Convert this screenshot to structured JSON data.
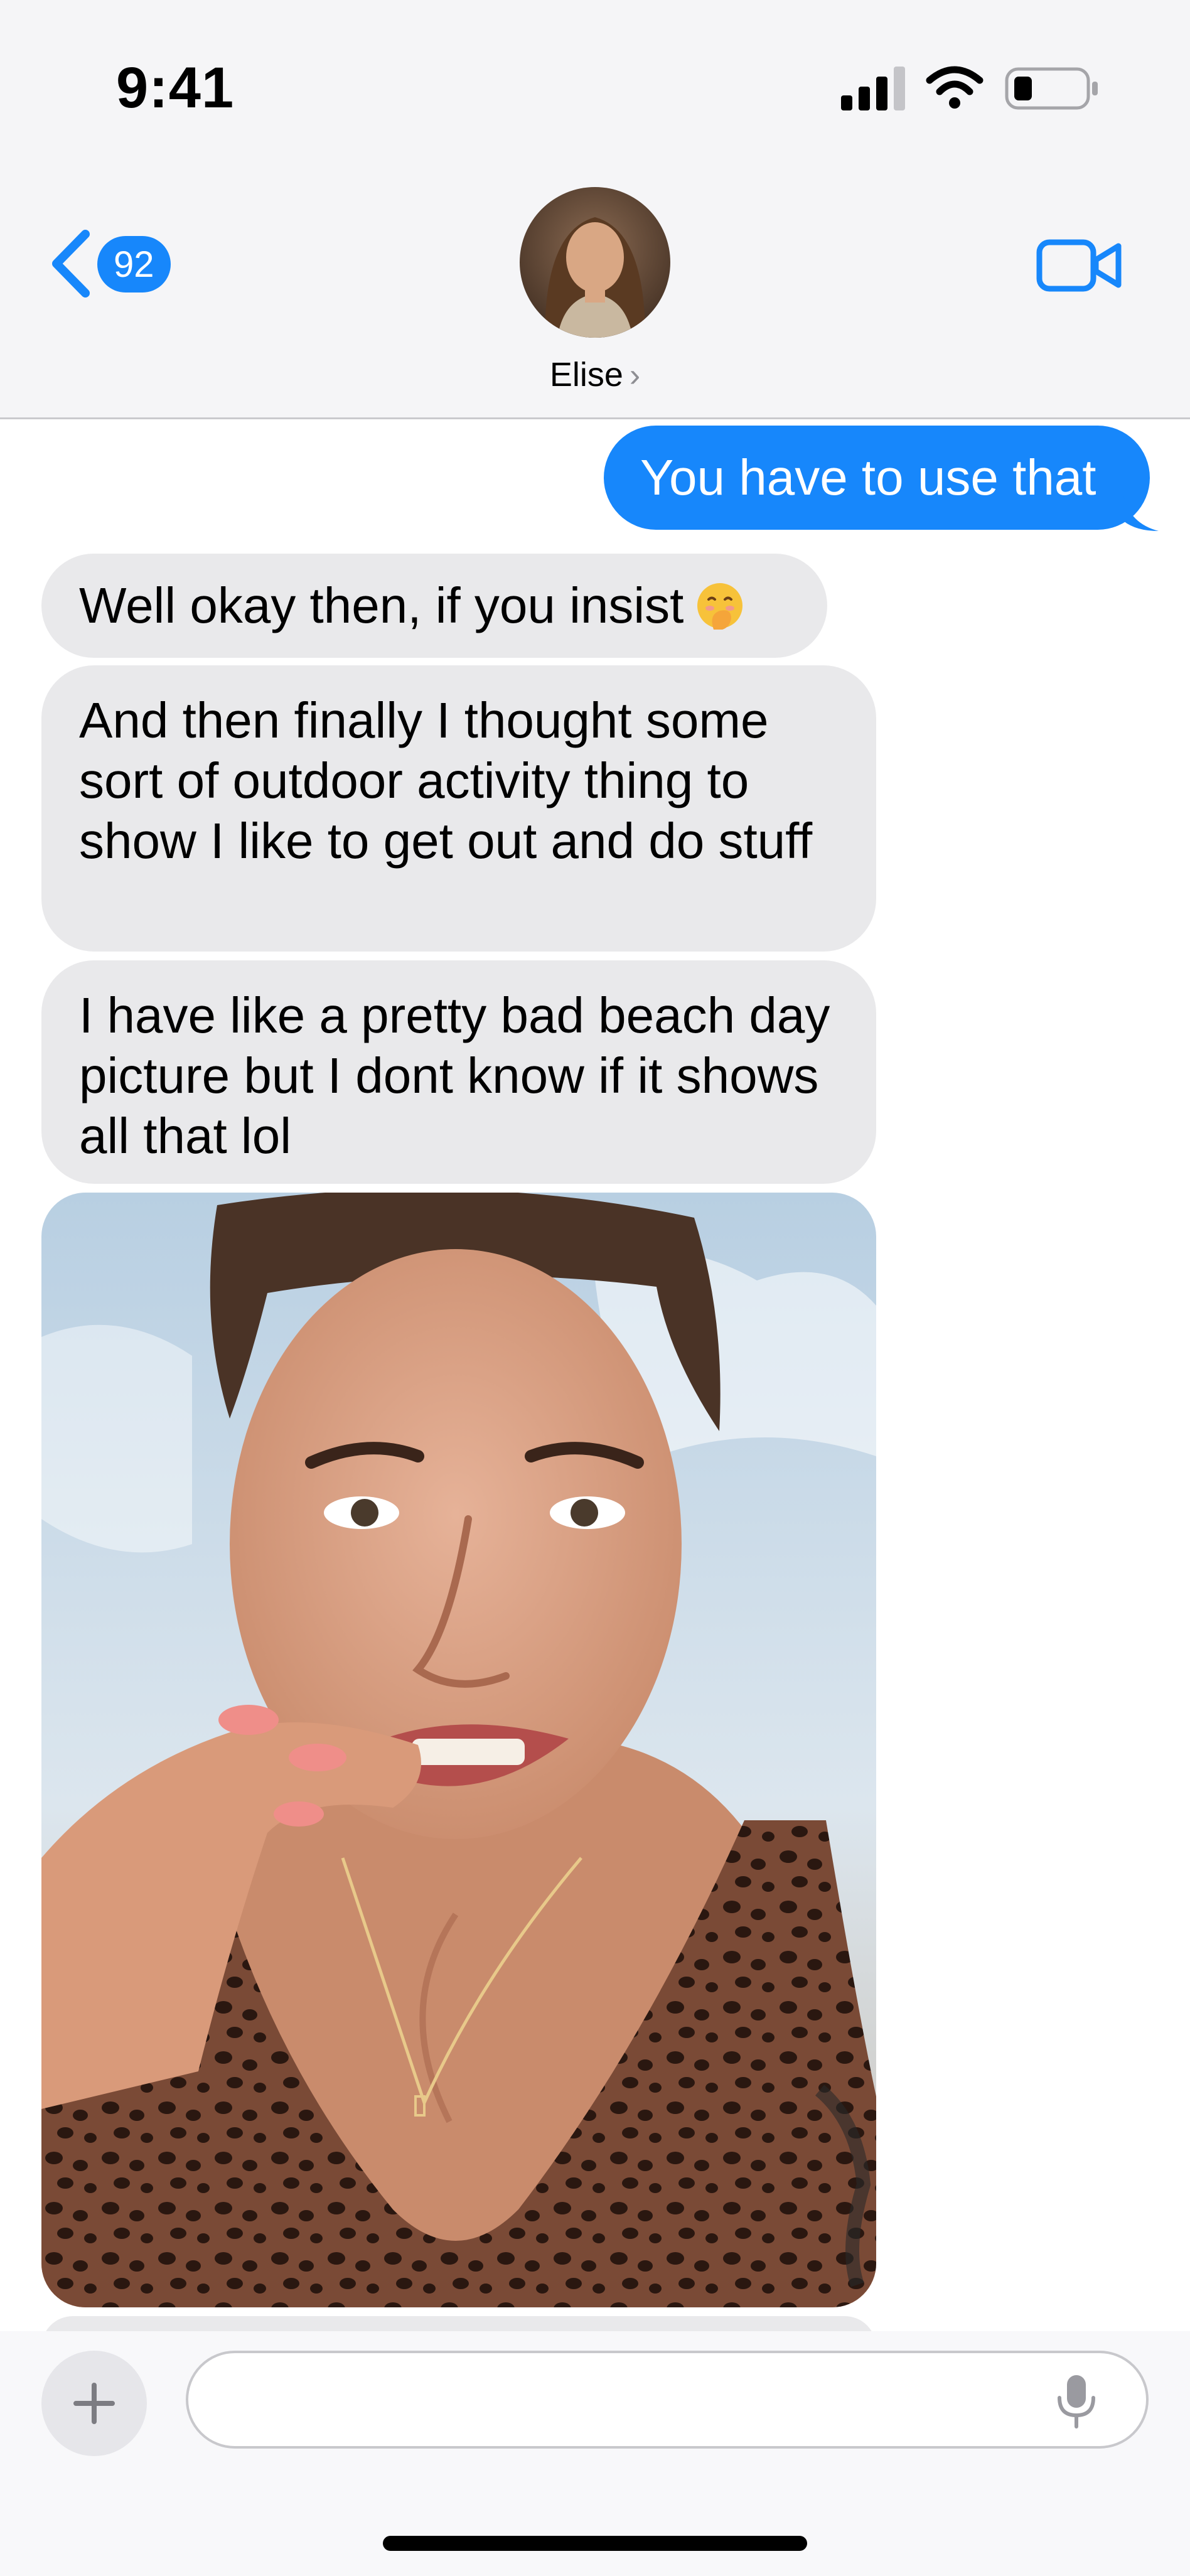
{
  "status_bar": {
    "time": "9:41",
    "icons": [
      "cellular-signal-icon",
      "wifi-icon",
      "battery-icon"
    ]
  },
  "header": {
    "back_badge": "92",
    "contact_name": "Elise",
    "contact_chevron": "›"
  },
  "messages": [
    {
      "direction": "sent",
      "text": "You have to use that"
    },
    {
      "direction": "received",
      "text": "Well okay then, if you insist",
      "emoji": "face-with-hand-over-mouth"
    },
    {
      "direction": "received",
      "text": "And then finally I thought some sort of outdoor activity thing to show I like to get out and do stuff"
    },
    {
      "direction": "received",
      "text": "I have like a pretty bad beach day picture but I dont know if it shows all that lol"
    },
    {
      "direction": "received",
      "type": "photo",
      "subject": "beach selfie"
    }
  ],
  "composer": {
    "value": "",
    "placeholder": ""
  },
  "colors": {
    "accent": "#1787fb",
    "received_bubble": "#e9e9eb",
    "header_bg": "#f5f5f7"
  }
}
